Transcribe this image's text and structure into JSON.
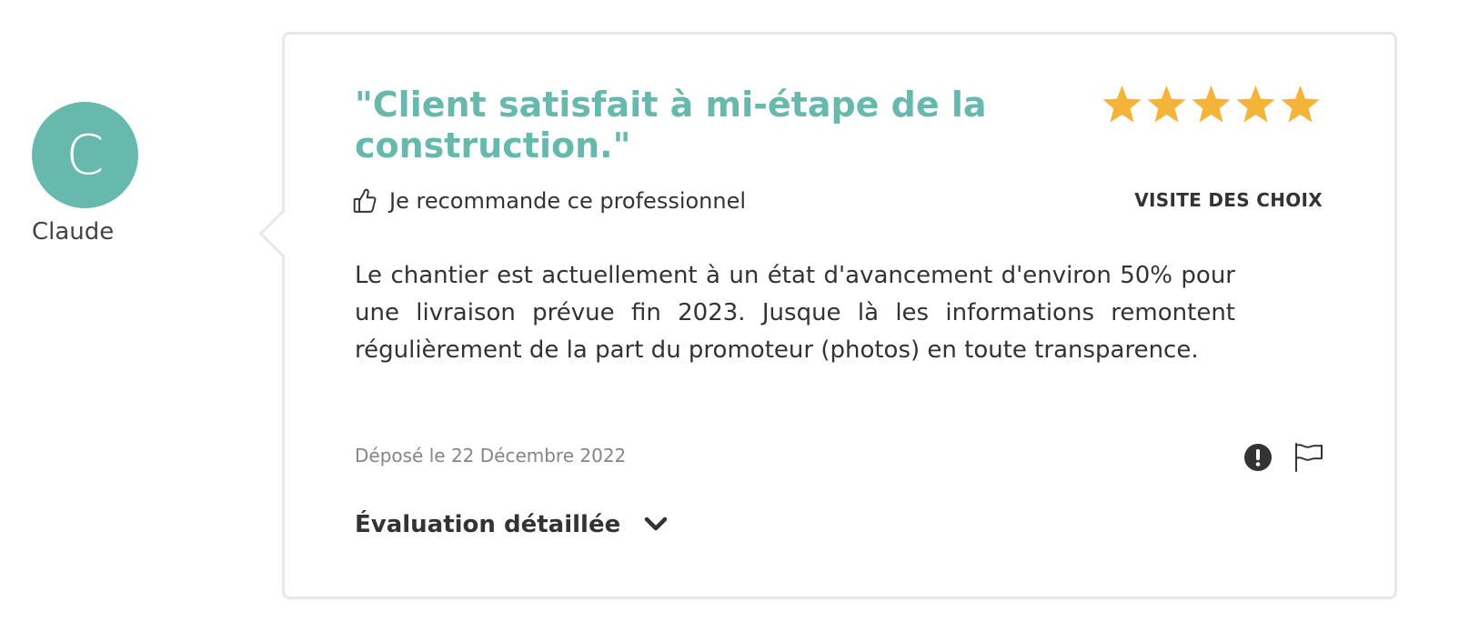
{
  "author": {
    "initial": "C",
    "name": "Claude",
    "avatar_color": "#68b9ad"
  },
  "review": {
    "title": "\"Client satisfait à mi-étape de la construction.\"",
    "rating": 5,
    "rating_max": 5,
    "star_color": "#f4b43a",
    "recommend_label": "Je recommande ce professionnel",
    "visit_type": "VISITE DES CHOIX",
    "body": "Le chantier est actuellement à un état d'avancement d'environ 50% pour une livraison prévue fin 2023. Jusque là les informations remontent régulièrement de la part du promoteur (photos) en toute transparence.",
    "posted_date": "Déposé le 22 Décembre 2022",
    "details_toggle_label": "Évaluation détaillée"
  },
  "icons": {
    "recommend": "thumbs-up-icon",
    "report": "alert-icon",
    "flag": "flag-icon",
    "expand": "chevron-down-icon"
  },
  "colors": {
    "accent": "#68b9ad",
    "text": "#333333",
    "muted": "#858585",
    "border": "#e8e8e8"
  }
}
